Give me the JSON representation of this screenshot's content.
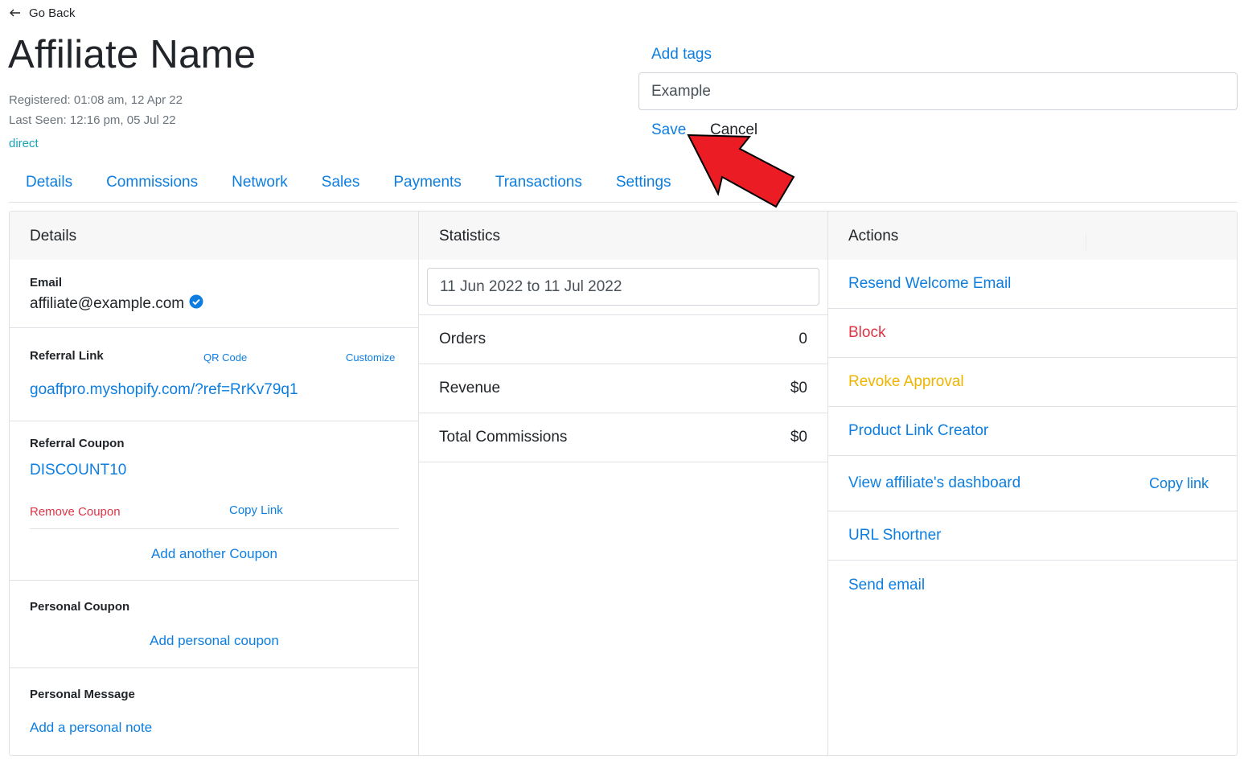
{
  "nav": {
    "back_label": "Go Back"
  },
  "affiliate": {
    "name": "Affiliate Name",
    "registered": "Registered: 01:08 am, 12 Apr 22",
    "last_seen": "Last Seen: 12:16 pm, 05 Jul 22",
    "source": "direct"
  },
  "tags": {
    "add_label": "Add tags",
    "input_value": "Example",
    "save_label": "Save",
    "cancel_label": "Cancel"
  },
  "tabs": [
    {
      "label": "Details"
    },
    {
      "label": "Commissions"
    },
    {
      "label": "Network"
    },
    {
      "label": "Sales"
    },
    {
      "label": "Payments"
    },
    {
      "label": "Transactions"
    },
    {
      "label": "Settings"
    }
  ],
  "details": {
    "heading": "Details",
    "email_label": "Email",
    "email_value": "affiliate@example.com",
    "referral_link_label": "Referral Link",
    "qr_code_label": "QR Code",
    "customize_label": "Customize",
    "referral_link_value": "goaffpro.myshopify.com/?ref=RrKv79q1",
    "referral_coupon_label": "Referral Coupon",
    "coupon_code": "DISCOUNT10",
    "remove_coupon_label": "Remove Coupon",
    "copy_link_label": "Copy Link",
    "add_another_coupon_label": "Add another Coupon",
    "personal_coupon_label": "Personal Coupon",
    "add_personal_coupon_label": "Add personal coupon",
    "personal_message_label": "Personal Message",
    "add_personal_note_label": "Add a personal note"
  },
  "statistics": {
    "heading": "Statistics",
    "date_range": "11 Jun 2022 to 11 Jul 2022",
    "rows": [
      {
        "label": "Orders",
        "value": "0"
      },
      {
        "label": "Revenue",
        "value": "$0"
      },
      {
        "label": "Total Commissions",
        "value": "$0"
      }
    ]
  },
  "actions": {
    "heading": "Actions",
    "resend_welcome": "Resend Welcome Email",
    "block": "Block",
    "revoke_approval": "Revoke Approval",
    "product_link_creator": "Product Link Creator",
    "view_dashboard": "View affiliate's dashboard",
    "copy_link": "Copy link",
    "url_shortner": "URL Shortner",
    "send_email": "Send email"
  },
  "colors": {
    "link": "#0d7ee0",
    "danger": "#dc3545",
    "warning": "#f0b400",
    "info": "#17a2b8",
    "verified": "#0d7ee0",
    "arrow": "#ec1c24"
  },
  "icons": {
    "back": "arrow-left-icon",
    "verified": "check-circle-icon"
  }
}
